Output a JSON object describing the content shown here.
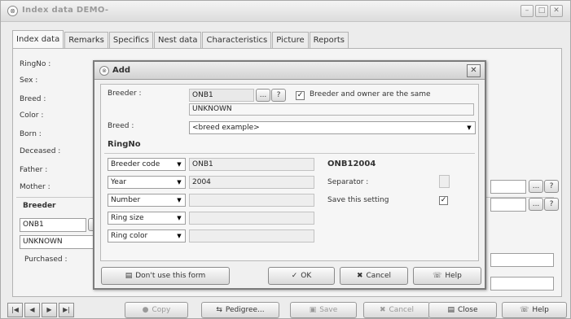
{
  "window": {
    "title": "Index data DEMO-",
    "minimize": "–",
    "maximize": "□",
    "close": "✕"
  },
  "tabs": [
    "Index data",
    "Remarks",
    "Specifics",
    "Nest data",
    "Characteristics",
    "Picture",
    "Reports"
  ],
  "form": {
    "ringno_label": "RingNo :",
    "sex_label": "Sex :",
    "breed_label": "Breed :",
    "color_label": "Color :",
    "born_label": "Born :",
    "deceased_label": "Deceased :",
    "father_label": "Father :",
    "mother_label": "Mother :",
    "breeder_heading": "Breeder",
    "breeder_code": "ONB1",
    "breeder_name": "UNKNOWN",
    "purchased_label": "Purchased :"
  },
  "bottom": {
    "first": "|◀",
    "prev": "◀",
    "next": "▶",
    "last": "▶|",
    "copy": "Copy",
    "pedigree": "Pedigree...",
    "save": "Save",
    "cancel": "Cancel",
    "close": "Close",
    "help": "Help"
  },
  "dialog": {
    "title": "Add",
    "close": "✕",
    "breeder_label": "Breeder :",
    "breeder_code": "ONB1",
    "browse_btn": "...",
    "help_btn": "?",
    "same_checkbox": "Breeder and owner are the same",
    "breeder_name": "UNKNOWN",
    "breed_label": "Breed :",
    "breed_value": "<breed example>",
    "ringno_heading": "RingNo",
    "rows": [
      {
        "field": "Breeder code",
        "value": "ONB1"
      },
      {
        "field": "Year",
        "value": "2004"
      },
      {
        "field": "Number",
        "value": ""
      },
      {
        "field": "Ring size",
        "value": ""
      },
      {
        "field": "Ring color",
        "value": ""
      }
    ],
    "ringno_result": "ONB12004",
    "separator_label": "Separator :",
    "save_setting_label": "Save this setting",
    "checkbox_mark": "✓",
    "buttons": {
      "dont_use": "Don't use this form",
      "ok": "OK",
      "cancel": "Cancel",
      "help": "Help"
    }
  }
}
